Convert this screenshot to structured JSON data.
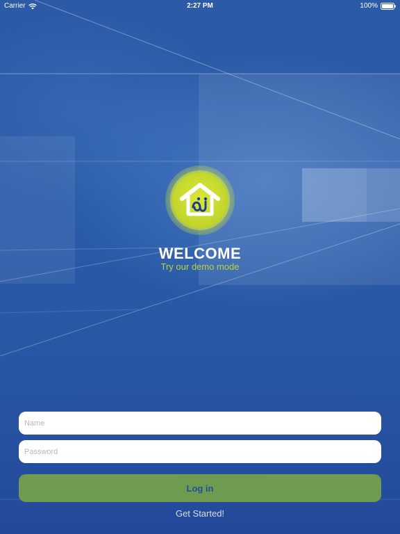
{
  "status_bar": {
    "carrier": "Carrier",
    "time": "2:27 PM",
    "battery": "100%",
    "icons": [
      "wifi-icon",
      "battery-icon"
    ]
  },
  "logo": {
    "icon": "house-logo-icon",
    "colors": {
      "ring": "#c4d82b",
      "house": "#ffffff",
      "mark": "#1f3c8f"
    }
  },
  "welcome": {
    "title": "WELCOME",
    "subtitle": "Try our demo mode"
  },
  "form": {
    "name_placeholder": "Name",
    "password_placeholder": "Password",
    "login_label": "Log in",
    "get_started_label": "Get Started!"
  },
  "colors": {
    "background": "#2a5ba8",
    "accent_green": "#76a24a",
    "subtitle_green": "#b9d43a",
    "button_text": "#1f4f9e"
  }
}
